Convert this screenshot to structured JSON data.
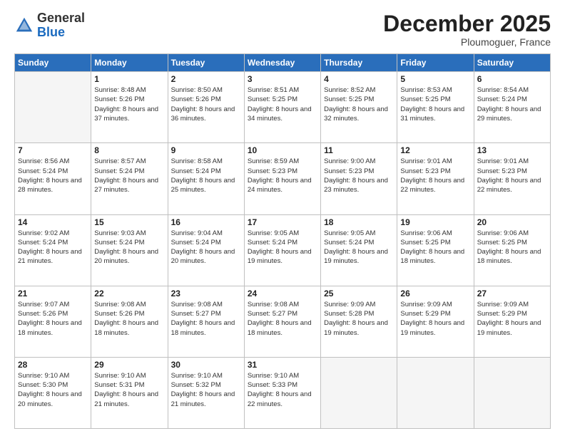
{
  "header": {
    "logo_general": "General",
    "logo_blue": "Blue",
    "month_title": "December 2025",
    "subtitle": "Ploumoguer, France"
  },
  "days_of_week": [
    "Sunday",
    "Monday",
    "Tuesday",
    "Wednesday",
    "Thursday",
    "Friday",
    "Saturday"
  ],
  "weeks": [
    [
      {
        "day": "",
        "sunrise": "",
        "sunset": "",
        "daylight": "",
        "empty": true
      },
      {
        "day": "1",
        "sunrise": "Sunrise: 8:48 AM",
        "sunset": "Sunset: 5:26 PM",
        "daylight": "Daylight: 8 hours and 37 minutes."
      },
      {
        "day": "2",
        "sunrise": "Sunrise: 8:50 AM",
        "sunset": "Sunset: 5:26 PM",
        "daylight": "Daylight: 8 hours and 36 minutes."
      },
      {
        "day": "3",
        "sunrise": "Sunrise: 8:51 AM",
        "sunset": "Sunset: 5:25 PM",
        "daylight": "Daylight: 8 hours and 34 minutes."
      },
      {
        "day": "4",
        "sunrise": "Sunrise: 8:52 AM",
        "sunset": "Sunset: 5:25 PM",
        "daylight": "Daylight: 8 hours and 32 minutes."
      },
      {
        "day": "5",
        "sunrise": "Sunrise: 8:53 AM",
        "sunset": "Sunset: 5:25 PM",
        "daylight": "Daylight: 8 hours and 31 minutes."
      },
      {
        "day": "6",
        "sunrise": "Sunrise: 8:54 AM",
        "sunset": "Sunset: 5:24 PM",
        "daylight": "Daylight: 8 hours and 29 minutes."
      }
    ],
    [
      {
        "day": "7",
        "sunrise": "Sunrise: 8:56 AM",
        "sunset": "Sunset: 5:24 PM",
        "daylight": "Daylight: 8 hours and 28 minutes."
      },
      {
        "day": "8",
        "sunrise": "Sunrise: 8:57 AM",
        "sunset": "Sunset: 5:24 PM",
        "daylight": "Daylight: 8 hours and 27 minutes."
      },
      {
        "day": "9",
        "sunrise": "Sunrise: 8:58 AM",
        "sunset": "Sunset: 5:24 PM",
        "daylight": "Daylight: 8 hours and 25 minutes."
      },
      {
        "day": "10",
        "sunrise": "Sunrise: 8:59 AM",
        "sunset": "Sunset: 5:23 PM",
        "daylight": "Daylight: 8 hours and 24 minutes."
      },
      {
        "day": "11",
        "sunrise": "Sunrise: 9:00 AM",
        "sunset": "Sunset: 5:23 PM",
        "daylight": "Daylight: 8 hours and 23 minutes."
      },
      {
        "day": "12",
        "sunrise": "Sunrise: 9:01 AM",
        "sunset": "Sunset: 5:23 PM",
        "daylight": "Daylight: 8 hours and 22 minutes."
      },
      {
        "day": "13",
        "sunrise": "Sunrise: 9:01 AM",
        "sunset": "Sunset: 5:23 PM",
        "daylight": "Daylight: 8 hours and 22 minutes."
      }
    ],
    [
      {
        "day": "14",
        "sunrise": "Sunrise: 9:02 AM",
        "sunset": "Sunset: 5:24 PM",
        "daylight": "Daylight: 8 hours and 21 minutes."
      },
      {
        "day": "15",
        "sunrise": "Sunrise: 9:03 AM",
        "sunset": "Sunset: 5:24 PM",
        "daylight": "Daylight: 8 hours and 20 minutes."
      },
      {
        "day": "16",
        "sunrise": "Sunrise: 9:04 AM",
        "sunset": "Sunset: 5:24 PM",
        "daylight": "Daylight: 8 hours and 20 minutes."
      },
      {
        "day": "17",
        "sunrise": "Sunrise: 9:05 AM",
        "sunset": "Sunset: 5:24 PM",
        "daylight": "Daylight: 8 hours and 19 minutes."
      },
      {
        "day": "18",
        "sunrise": "Sunrise: 9:05 AM",
        "sunset": "Sunset: 5:24 PM",
        "daylight": "Daylight: 8 hours and 19 minutes."
      },
      {
        "day": "19",
        "sunrise": "Sunrise: 9:06 AM",
        "sunset": "Sunset: 5:25 PM",
        "daylight": "Daylight: 8 hours and 18 minutes."
      },
      {
        "day": "20",
        "sunrise": "Sunrise: 9:06 AM",
        "sunset": "Sunset: 5:25 PM",
        "daylight": "Daylight: 8 hours and 18 minutes."
      }
    ],
    [
      {
        "day": "21",
        "sunrise": "Sunrise: 9:07 AM",
        "sunset": "Sunset: 5:26 PM",
        "daylight": "Daylight: 8 hours and 18 minutes."
      },
      {
        "day": "22",
        "sunrise": "Sunrise: 9:08 AM",
        "sunset": "Sunset: 5:26 PM",
        "daylight": "Daylight: 8 hours and 18 minutes."
      },
      {
        "day": "23",
        "sunrise": "Sunrise: 9:08 AM",
        "sunset": "Sunset: 5:27 PM",
        "daylight": "Daylight: 8 hours and 18 minutes."
      },
      {
        "day": "24",
        "sunrise": "Sunrise: 9:08 AM",
        "sunset": "Sunset: 5:27 PM",
        "daylight": "Daylight: 8 hours and 18 minutes."
      },
      {
        "day": "25",
        "sunrise": "Sunrise: 9:09 AM",
        "sunset": "Sunset: 5:28 PM",
        "daylight": "Daylight: 8 hours and 19 minutes."
      },
      {
        "day": "26",
        "sunrise": "Sunrise: 9:09 AM",
        "sunset": "Sunset: 5:29 PM",
        "daylight": "Daylight: 8 hours and 19 minutes."
      },
      {
        "day": "27",
        "sunrise": "Sunrise: 9:09 AM",
        "sunset": "Sunset: 5:29 PM",
        "daylight": "Daylight: 8 hours and 19 minutes."
      }
    ],
    [
      {
        "day": "28",
        "sunrise": "Sunrise: 9:10 AM",
        "sunset": "Sunset: 5:30 PM",
        "daylight": "Daylight: 8 hours and 20 minutes."
      },
      {
        "day": "29",
        "sunrise": "Sunrise: 9:10 AM",
        "sunset": "Sunset: 5:31 PM",
        "daylight": "Daylight: 8 hours and 21 minutes."
      },
      {
        "day": "30",
        "sunrise": "Sunrise: 9:10 AM",
        "sunset": "Sunset: 5:32 PM",
        "daylight": "Daylight: 8 hours and 21 minutes."
      },
      {
        "day": "31",
        "sunrise": "Sunrise: 9:10 AM",
        "sunset": "Sunset: 5:33 PM",
        "daylight": "Daylight: 8 hours and 22 minutes."
      },
      {
        "day": "",
        "sunrise": "",
        "sunset": "",
        "daylight": "",
        "empty": true
      },
      {
        "day": "",
        "sunrise": "",
        "sunset": "",
        "daylight": "",
        "empty": true
      },
      {
        "day": "",
        "sunrise": "",
        "sunset": "",
        "daylight": "",
        "empty": true
      }
    ]
  ]
}
